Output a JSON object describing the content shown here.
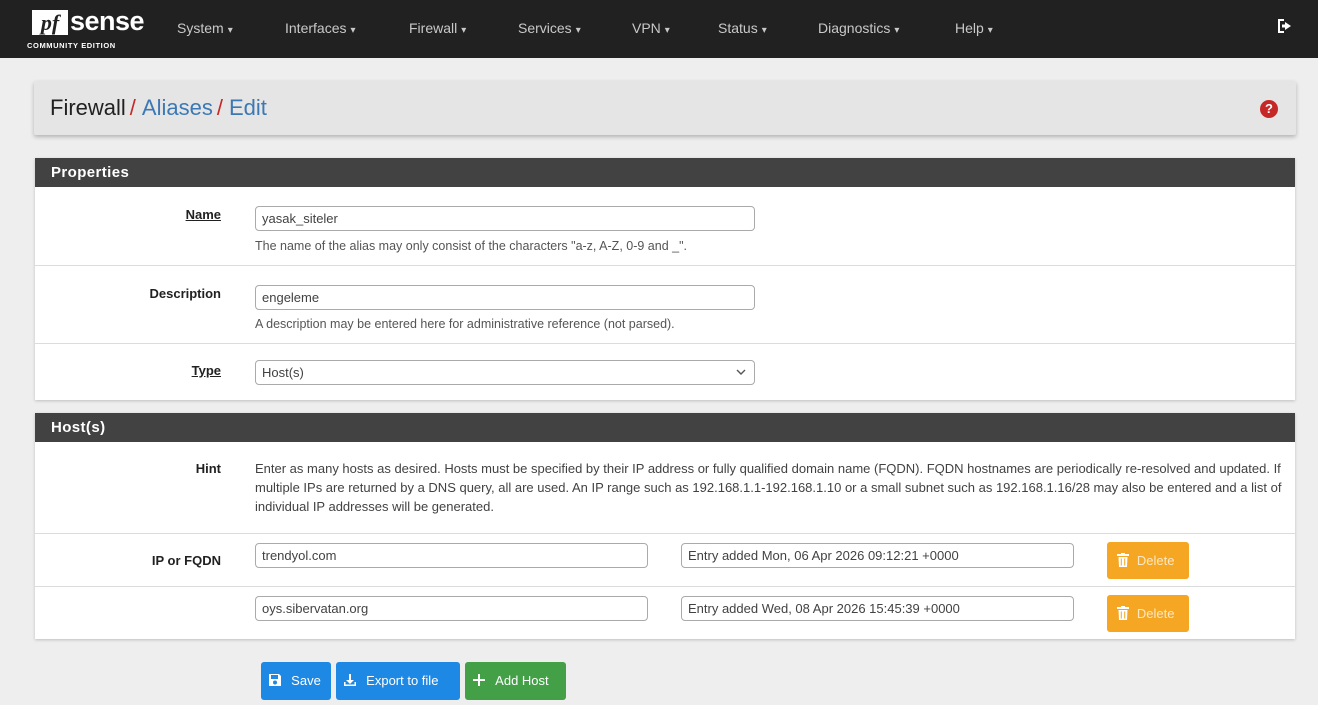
{
  "brand": {
    "logo_pf": "pf",
    "logo_sense": "sense",
    "edition": "COMMUNITY EDITION"
  },
  "nav": {
    "items": [
      {
        "label": "System"
      },
      {
        "label": "Interfaces"
      },
      {
        "label": "Firewall"
      },
      {
        "label": "Services"
      },
      {
        "label": "VPN"
      },
      {
        "label": "Status"
      },
      {
        "label": "Diagnostics"
      },
      {
        "label": "Help"
      }
    ],
    "caret": "▾"
  },
  "breadcrumb": {
    "root": "Firewall",
    "level1": "Aliases",
    "level2": "Edit",
    "sep": "/"
  },
  "help_icon": "?",
  "properties": {
    "heading": "Properties",
    "name_label": "Name",
    "name_value": "yasak_siteler",
    "name_help": "The name of the alias may only consist of the characters \"a-z, A-Z, 0-9 and _\".",
    "desc_label": "Description",
    "desc_value": "engeleme",
    "desc_help": "A description may be entered here for administrative reference (not parsed).",
    "type_label": "Type",
    "type_value": "Host(s)"
  },
  "hosts": {
    "heading": "Host(s)",
    "hint_label": "Hint",
    "hint_text": "Enter as many hosts as desired. Hosts must be specified by their IP address or fully qualified domain name (FQDN). FQDN hostnames are periodically re-resolved and updated. If multiple IPs are returned by a DNS query, all are used. An IP range such as 192.168.1.1-192.168.1.10 or a small subnet such as 192.168.1.16/28 may also be entered and a list of individual IP addresses will be generated.",
    "ip_label": "IP or FQDN",
    "entries": [
      {
        "host": "trendyol.com",
        "note": "Entry added Mon, 06 Apr 2026 09:12:21 +0000",
        "delete": "Delete"
      },
      {
        "host": "oys.sibervatan.org",
        "note": "Entry added Wed, 08 Apr 2026 15:45:39 +0000",
        "delete": "Delete"
      }
    ]
  },
  "buttons": {
    "save": "Save",
    "export": "Export to file",
    "add_host": "Add Host"
  },
  "colors": {
    "navbar": "#212121",
    "panel_heading": "#424242",
    "link": "#3c78b4",
    "separator": "#c62828",
    "delete": "#f5a623",
    "primary": "#1e88e5",
    "success": "#43a047"
  }
}
